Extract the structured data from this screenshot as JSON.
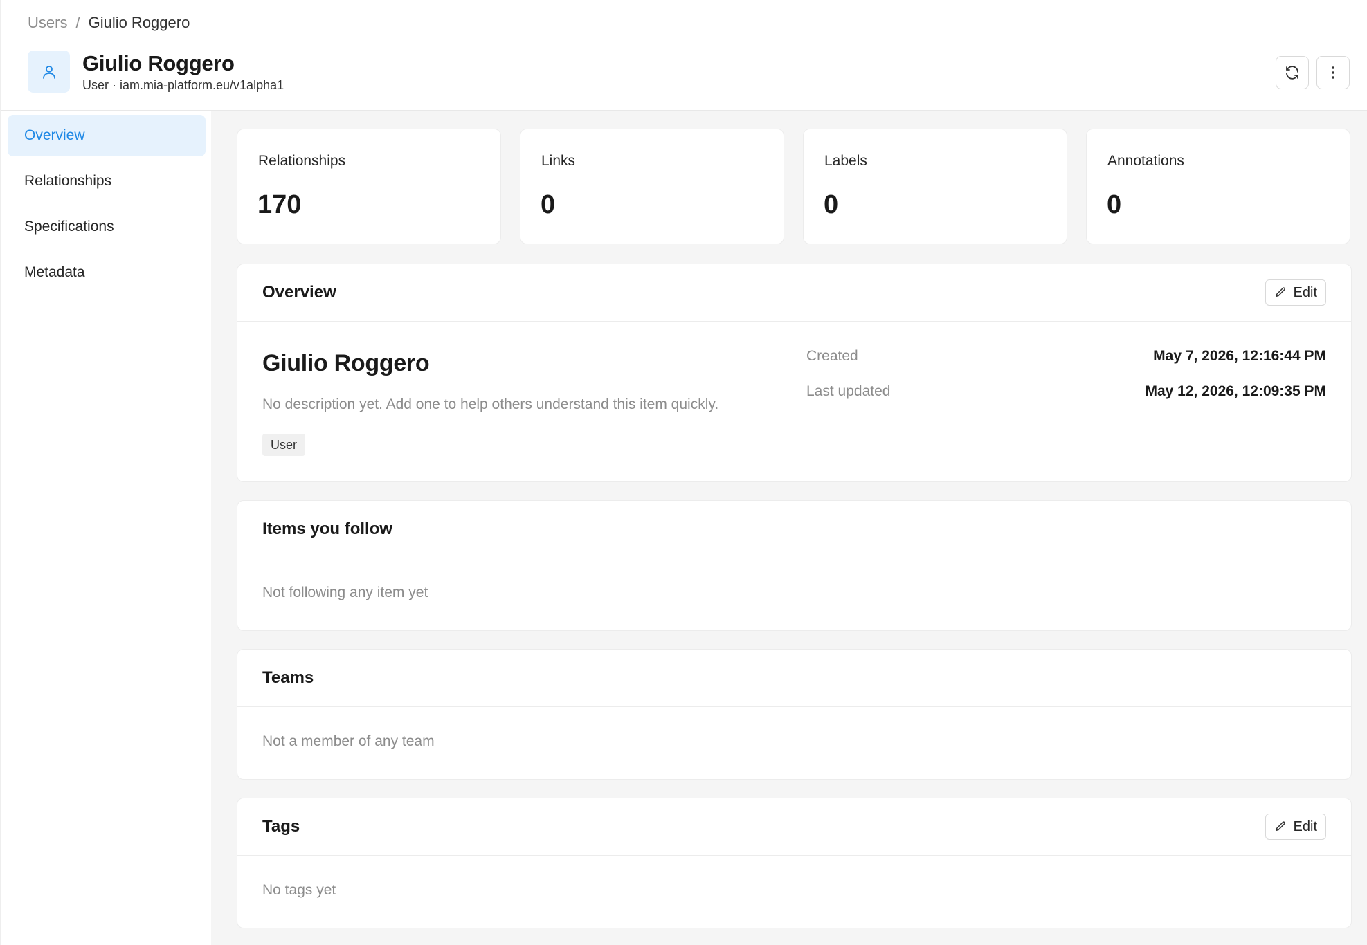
{
  "colors": {
    "accent": "#1e88e5",
    "accent_bg": "#e6f2fd",
    "muted": "#8c8c8c",
    "page_bg": "#f5f5f5"
  },
  "breadcrumb": {
    "parent": "Users",
    "separator": "/",
    "current": "Giulio Roggero"
  },
  "header": {
    "icon": "user-icon",
    "title": "Giulio Roggero",
    "subtitle": "User · iam.mia-platform.eu/v1alpha1",
    "actions": [
      "refresh-icon",
      "more-vertical-icon"
    ]
  },
  "sidebar": {
    "items": [
      {
        "label": "Overview",
        "active": true
      },
      {
        "label": "Relationships",
        "active": false
      },
      {
        "label": "Specifications",
        "active": false
      },
      {
        "label": "Metadata",
        "active": false
      }
    ]
  },
  "stats": [
    {
      "label": "Relationships",
      "value": "170"
    },
    {
      "label": "Links",
      "value": "0"
    },
    {
      "label": "Labels",
      "value": "0"
    },
    {
      "label": "Annotations",
      "value": "0"
    }
  ],
  "overview": {
    "title": "Overview",
    "edit_label": "Edit",
    "name": "Giulio Roggero",
    "description": "No description yet. Add one to help others understand this item quickly.",
    "badge": "User",
    "created_label": "Created",
    "created_value": "May 7, 2026, 12:16:44 PM",
    "updated_label": "Last updated",
    "updated_value": "May 12, 2026, 12:09:35 PM"
  },
  "following": {
    "title": "Items you follow",
    "empty": "Not following any item yet"
  },
  "teams": {
    "title": "Teams",
    "empty": "Not a member of any team"
  },
  "tags": {
    "title": "Tags",
    "edit_label": "Edit",
    "empty": "No tags yet"
  }
}
